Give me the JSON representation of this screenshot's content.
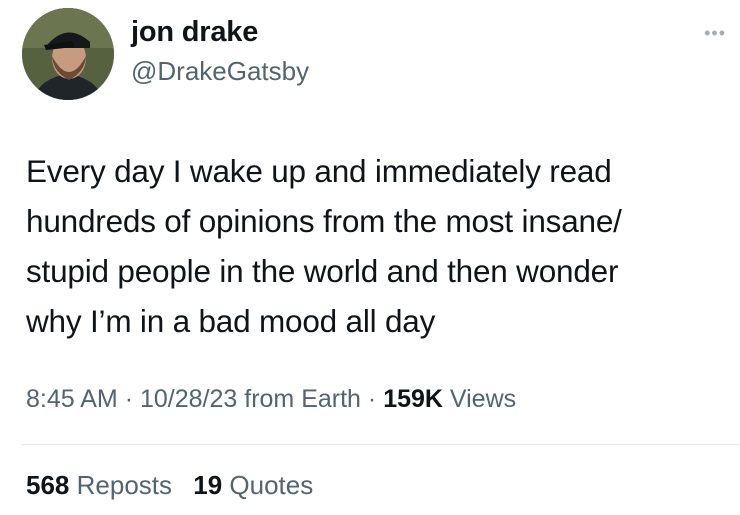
{
  "author": {
    "display_name": "jon drake",
    "handle": "@DrakeGatsby"
  },
  "menu_icon": "more-horizontal-icon",
  "tweet": {
    "lines": [
      "Every day I wake up and immediately read",
      "hundreds of opinions from the most insane/",
      "stupid people in the world and then wonder",
      "why I’m in a bad mood all day"
    ]
  },
  "meta": {
    "time": "8:45 AM",
    "separator": "·",
    "date": "10/28/23",
    "source": "from Earth",
    "views_count": "159K",
    "views_label": "Views"
  },
  "stats": {
    "reposts_count": "568",
    "reposts_label": "Reposts",
    "quotes_count": "19",
    "quotes_label": "Quotes"
  }
}
